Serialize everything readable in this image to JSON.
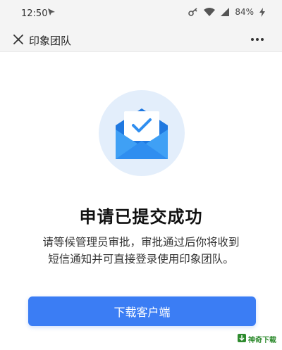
{
  "status_bar": {
    "time": "12:50",
    "battery": "84%",
    "icons": [
      "cast-icon",
      "key-icon",
      "wifi-icon",
      "signal-icon",
      "charging-icon"
    ]
  },
  "nav": {
    "close_icon": "close-icon",
    "title": "印象团队",
    "more_icon": "more-icon"
  },
  "content": {
    "illustration": "envelope-check-icon",
    "headline": "申请已提交成功",
    "message_line1": "请等候管理员审批，审批通过后你将收到",
    "message_line2": "短信通知并可直接登录使用印象团队。",
    "button_label": "下载客户端"
  },
  "colors": {
    "accent": "#3b7df4",
    "bar_bg": "#f4f4f4",
    "circle_bg": "#e3eefb",
    "envelope": "#2f8ef0"
  },
  "watermark": {
    "text": "神奇下载"
  }
}
